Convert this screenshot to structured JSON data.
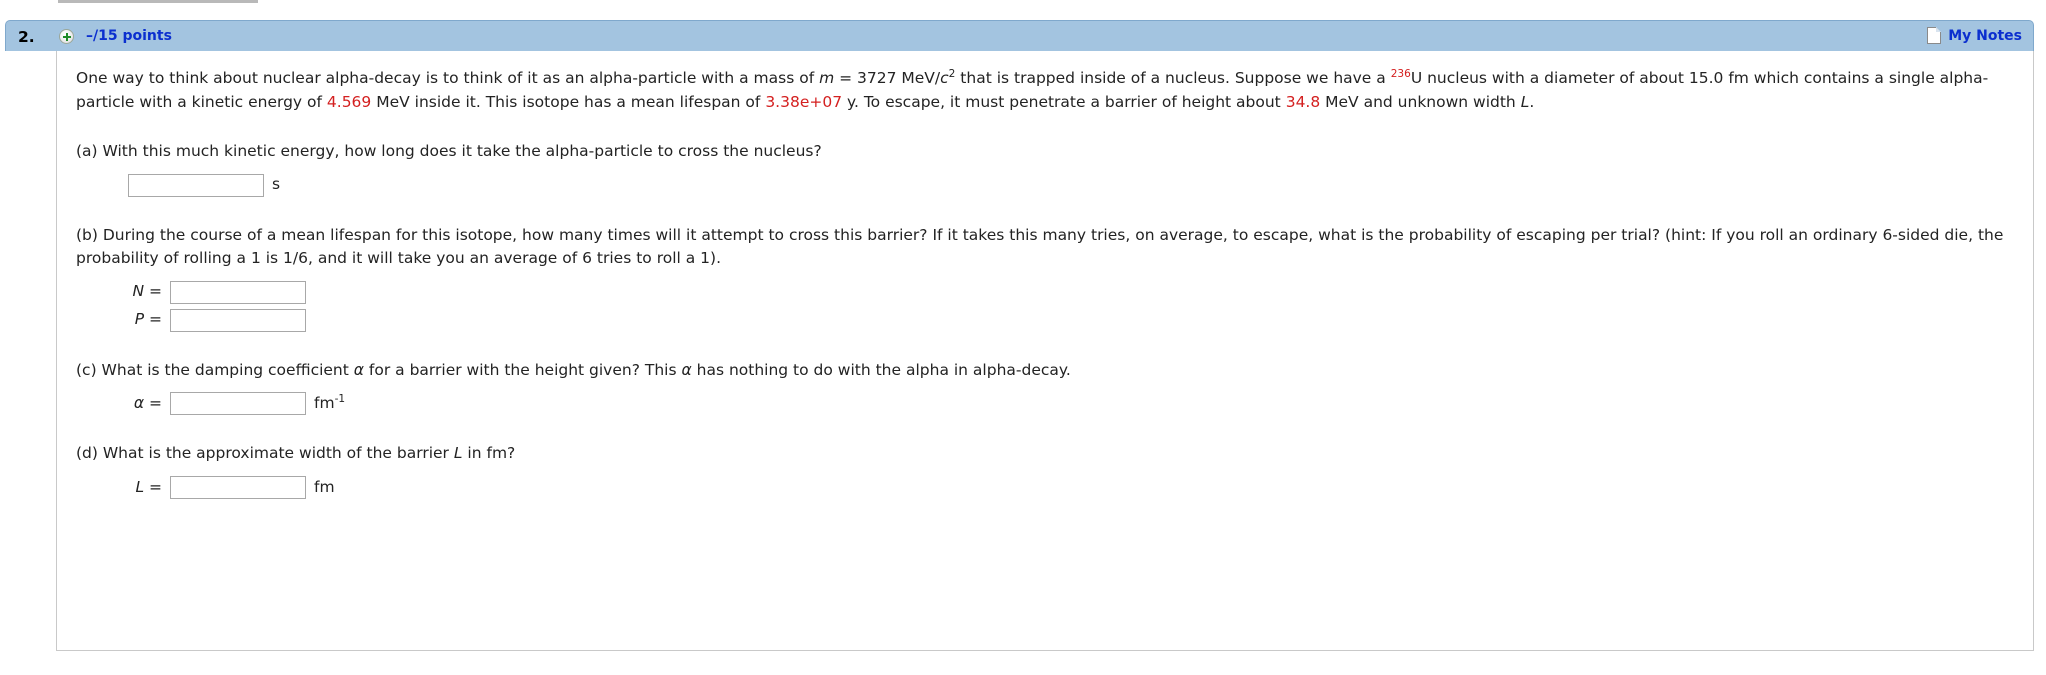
{
  "header": {
    "question_number": "2.",
    "expand_icon": "plus-circle-icon",
    "points": "–/15 points",
    "notes_icon": "note-page-icon",
    "notes_label": "My Notes",
    "bar_color": "#a3c4e0",
    "link_color": "#0b2fcf"
  },
  "prompt": {
    "s1": "One way to think about nuclear alpha-decay is to think of it as an alpha-particle with a mass of ",
    "m_var": "m",
    "s2": " = 3727 MeV/",
    "c_var": "c",
    "c_exp": "2",
    "s3": " that is trapped inside of a nucleus. Suppose we have a ",
    "u_mass": "236",
    "u_sym": "U",
    "s4": " nucleus with a diameter of about 15.0 fm which contains a single alpha-particle with a kinetic energy of ",
    "ke_value": "4.569",
    "s5": " MeV inside it. This isotope has a mean lifespan of ",
    "lifespan_value": "3.38e+07",
    "s6": " y. To escape, it must penetrate a barrier of height about ",
    "barrier_value": "34.8",
    "s7": " MeV and unknown width ",
    "L_var": "L",
    "s8": "."
  },
  "parts": [
    {
      "label": "(a)",
      "text": "(a) With this much kinetic energy, how long does it take the alpha-particle to cross the nucleus?",
      "answers": [
        {
          "label": "",
          "value": "",
          "unit": "s",
          "unit_exp": ""
        }
      ]
    },
    {
      "label": "(b)",
      "text": "(b) During the course of a mean lifespan for this isotope, how many times will it attempt to cross this barrier? If it takes this many tries, on average, to escape, what is the probability of escaping per trial? (hint: If you roll an ordinary 6-sided die, the probability of rolling a 1 is 1/6, and it will take you an average of 6 tries to roll a 1).",
      "answers": [
        {
          "label": "N =",
          "value": "",
          "unit": "",
          "unit_exp": ""
        },
        {
          "label": "P =",
          "value": "",
          "unit": "",
          "unit_exp": ""
        }
      ]
    },
    {
      "label": "(c)",
      "text_pre": "(c) What is the damping coefficient ",
      "alpha": "α",
      "text_mid": " for a barrier with the height given? This ",
      "text_post": " has nothing to do with the alpha in alpha-decay.",
      "answers": [
        {
          "label": "α =",
          "value": "",
          "unit": "fm",
          "unit_exp": "-1"
        }
      ]
    },
    {
      "label": "(d)",
      "text_pre": "(d) What is the approximate width of the barrier ",
      "L_var": "L",
      "text_post": " in fm?",
      "answers": [
        {
          "label": "L =",
          "value": "",
          "unit": "fm",
          "unit_exp": ""
        }
      ]
    }
  ]
}
